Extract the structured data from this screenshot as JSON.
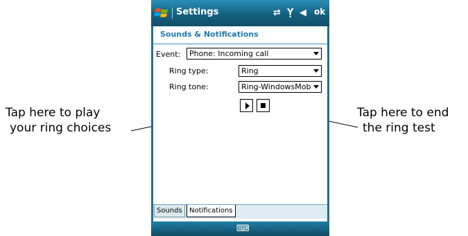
{
  "titlebar": {
    "title": "Settings",
    "icons": [
      "windows-start-icon",
      "connectivity-icon",
      "signal-icon",
      "volume-icon"
    ],
    "ok_label": "ok"
  },
  "page": {
    "header": "Sounds & Notifications",
    "event_label": "Event:",
    "event_value": "Phone: Incoming call",
    "ring_type_label": "Ring type:",
    "ring_type_value": "Ring",
    "ring_tone_label": "Ring tone:",
    "ring_tone_value": "Ring-WindowsMob"
  },
  "tabs": [
    {
      "label": "Sounds",
      "active": false
    },
    {
      "label": "Notifications",
      "active": true
    }
  ],
  "softbar": {
    "icon": "keyboard-icon"
  },
  "callouts": {
    "left_line1": "Tap here to play",
    "left_line2": "your ring choices",
    "right_line1": "Tap here to end",
    "right_line2": "the ring test"
  },
  "colors": {
    "title_bar": "#14607f",
    "header_text": "#1e79b4",
    "tab_strip": "#ddecf1"
  }
}
